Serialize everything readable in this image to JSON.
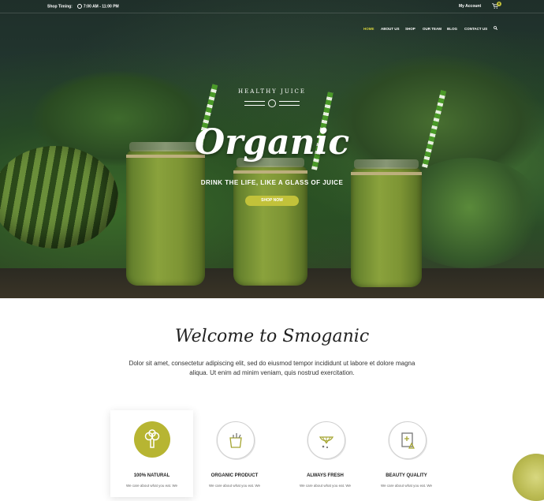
{
  "topbar": {
    "timing_label": "Shop Timing:",
    "timing_value": "7:00 AM - 11:00 PM",
    "account": "My Account",
    "cart_count": "0",
    "accent": "#c2c23a"
  },
  "nav": {
    "items": [
      {
        "label": "HOME",
        "active": true
      },
      {
        "label": "ABOUT US"
      },
      {
        "label": "SHOP"
      },
      {
        "label": "OUR TEAM"
      },
      {
        "label": "BLOG"
      },
      {
        "label": "CONTACT US"
      }
    ],
    "search_icon": "search-icon"
  },
  "hero": {
    "badge_text": "HEALTHY JUICE",
    "title": "Organic",
    "tagline": "DRINK THE LIFE, LIKE A GLASS OF JUICE",
    "button": "SHOP NOW"
  },
  "welcome": {
    "heading": "Welcome to Smoganic",
    "text": "Dolor sit amet, consectetur adipiscing elit, sed do eiusmod tempor incididunt ut labore et dolore magna aliqua. Ut enim ad minim veniam, quis nostrud exercitation."
  },
  "features": [
    {
      "name": "100% NATURAL",
      "desc": "We care about what you eat. We",
      "icon": "broccoli-icon"
    },
    {
      "name": "ORGANIC PRODUCT",
      "desc": "We care about what you eat. We",
      "icon": "grocery-bag-icon"
    },
    {
      "name": "ALWAYS FRESH",
      "desc": "We care about what you eat. We",
      "icon": "citrus-slice-icon"
    },
    {
      "name": "BEAUTY QUALITY",
      "desc": "We care about what you eat. We",
      "icon": "quality-certificate-icon"
    }
  ]
}
